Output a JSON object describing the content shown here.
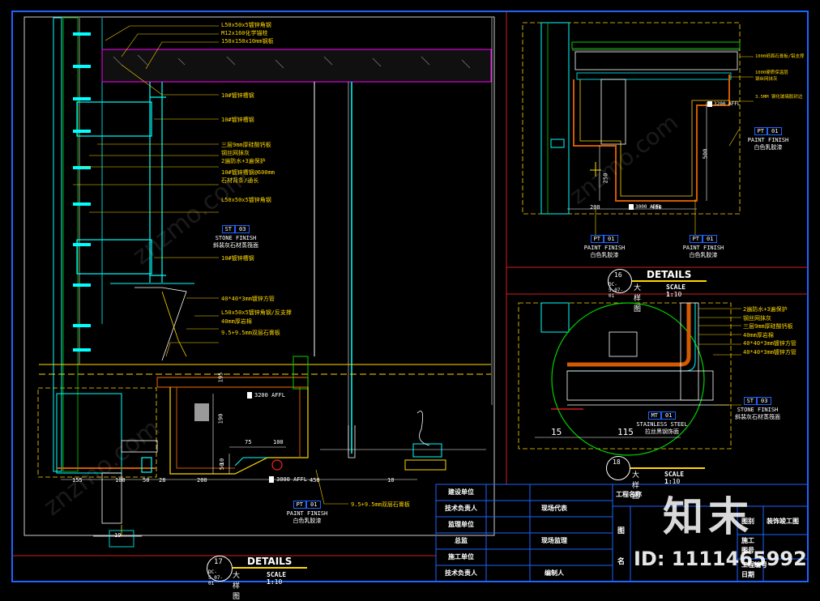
{
  "left_notes": [
    "L50x50x5镀锌角钢",
    "M12x160化学锚栓",
    "150x150x10mm钢板",
    "10#镀锌槽钢",
    "10#镀锌槽钢",
    "三层9mm厚硅酸钙板",
    "钢丝网抹灰",
    "2遍防水+3遍保护",
    "10#镀锌槽钢@600mm",
    "石材背条/通长",
    "L50x50x5镀锌角钢",
    "10#镀锌槽钢",
    "40*40*3mm镀锌方管",
    "L50x50x5镀锌角钢/反支撑",
    "40mm厚岩棉",
    "9.5+9.5mm双层石膏板"
  ],
  "left_materials": {
    "stone": {
      "code": "ST",
      "num": "03",
      "finish": "STONE FINISH",
      "cn": "斜裴灰石材蒸筏面"
    },
    "paint": {
      "code": "PT",
      "num": "01",
      "finish": "PAINT FINISH",
      "cn": "白色乳胶漆"
    },
    "board_note": "9.5+9.5mm双层石膏板"
  },
  "left_dims": {
    "h195": "195",
    "h190": "190",
    "h50": "50",
    "h10": "10",
    "d75": "75",
    "d100": "100",
    "bottom": [
      "155",
      "100",
      "50",
      "28",
      "200",
      "450",
      "10"
    ],
    "level_a": "3200 AFFL",
    "level_b": "3000 AFFL"
  },
  "detail17": {
    "num": "17",
    "sheet": "DC-5.07-01",
    "title": "DETAILS",
    "cn": "大样图",
    "scale": "SCALE 1:",
    "scale_val": "10"
  },
  "detail19_num": "19",
  "detail16": {
    "num": "16",
    "sheet": "DC-5.07-01",
    "title": "DETAILS",
    "cn": "大样图",
    "scale": "SCALE 1:",
    "scale_val": "10"
  },
  "detail18": {
    "num": "18",
    "title": "大样图",
    "scale": "SCALE 1:",
    "scale_val": "10"
  },
  "right_top": {
    "notes": [
      "1000纸面石膏板/铝支撑",
      "1000硬质保温层",
      "钢丝网抹灰",
      "3.5MM 钢化玻璃胶封边"
    ],
    "level_a": "3200 AFFL",
    "level_b": "3000 AFFL",
    "dim500": "500",
    "dim250": "250",
    "dim200": "200",
    "dim400": "400",
    "paints": [
      {
        "code": "PT",
        "num": "01",
        "finish": "PAINT FINISH",
        "cn": "白色乳胶漆"
      },
      {
        "code": "PT",
        "num": "01",
        "finish": "PAINT FINISH",
        "cn": "白色乳胶漆"
      },
      {
        "code": "PT",
        "num": "01",
        "finish": "PAINT FINISH",
        "cn": "白色乳胶漆"
      }
    ]
  },
  "right_mid": {
    "notes": [
      "2遍防水+3遍保护",
      "钢丝网抹灰",
      "三层9mm厚硅酸钙板",
      "40mm厚岩棉",
      "40*40*3mm镀锌方管",
      "40*40*3mm镀锌方管"
    ],
    "stone": {
      "code": "ST",
      "num": "03",
      "finish": "STONE FINISH",
      "cn": "斜裴灰石材蒸筏面"
    },
    "metal": {
      "code": "MT",
      "num": "01",
      "finish": "STAINLESS STEEL",
      "cn": "拉丝黑钢饰面"
    },
    "dim15": "15",
    "dim115": "115"
  },
  "title_block": {
    "rows_left": [
      "建设单位",
      "技术负责人",
      "监理单位",
      "总监",
      "施工单位",
      "技术负责人"
    ],
    "rows_mid": [
      "",
      "现场代表",
      "",
      "现场监理",
      "",
      "编制人"
    ],
    "project_label": "工程名称",
    "fig_label": "图",
    "name_label": "名",
    "fig_no": "图别",
    "fig_type": "装饰竣工图",
    "fields": [
      "施工",
      "图号",
      "工程编号",
      "日期"
    ]
  },
  "watermark": {
    "brand": "知末",
    "id": "ID: 1111465992",
    "site": "znzmo.com"
  },
  "colors": {
    "frame": "#1e64ff",
    "red": "#d21e1e",
    "yellow": "#ffd700",
    "cyan": "#00ffff",
    "green": "#00d200",
    "magenta": "#ff00ff",
    "white": "#ffffff"
  }
}
